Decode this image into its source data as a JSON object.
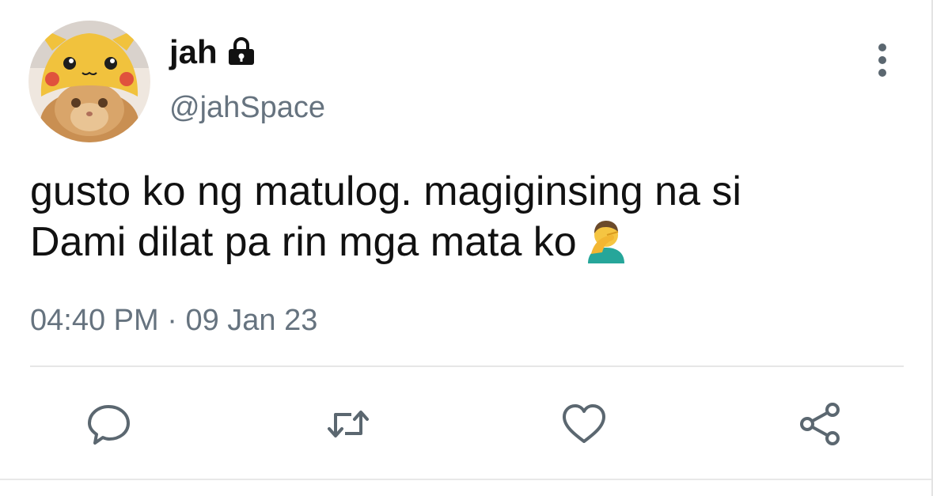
{
  "user": {
    "display_name": "jah",
    "handle": "@jahSpace",
    "protected_icon": "lock-icon",
    "avatar": "avatar-cat-in-pikachu-hat"
  },
  "tweet": {
    "text_line1": "gusto ko ng matulog. magiginsing na si",
    "text_line2": "Dami dilat pa rin mga mata ko",
    "emoji": "facepalm-emoji",
    "time": "04:40 PM",
    "separator": "·",
    "date": "09 Jan 23"
  },
  "actions": [
    "reply-icon",
    "retweet-icon",
    "like-icon",
    "share-icon"
  ],
  "colors": {
    "text": "#111111",
    "muted": "#66737f",
    "icon": "#5b6770",
    "divider": "#e6e6e6"
  }
}
